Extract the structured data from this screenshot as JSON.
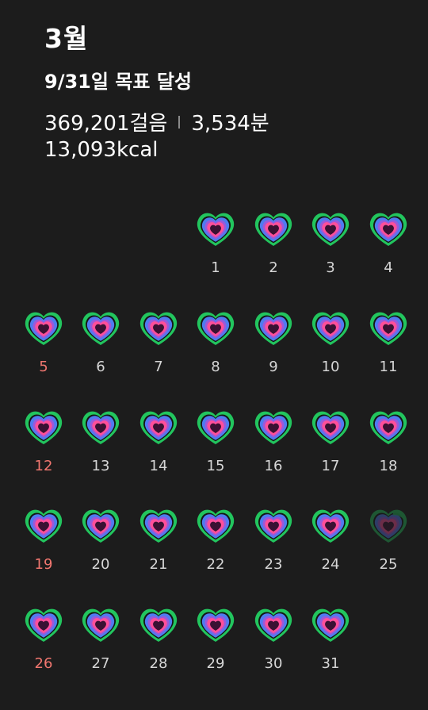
{
  "header": {
    "month": "3월",
    "goal": "9/31일 목표 달성",
    "steps": "369,201걸음",
    "minutes": "3,534분",
    "kcal": "13,093kcal"
  },
  "calendar": {
    "first_weekday_index": 3,
    "sunday_color": "#f0766f",
    "ring_colors": [
      "#22c55e",
      "#4f7bf0",
      "#9b59d9",
      "#ff4f9a",
      "#3a1133"
    ],
    "days": [
      {
        "label": "1",
        "sunday": false,
        "complete": true
      },
      {
        "label": "2",
        "sunday": false,
        "complete": true
      },
      {
        "label": "3",
        "sunday": false,
        "complete": true
      },
      {
        "label": "4",
        "sunday": false,
        "complete": true
      },
      {
        "label": "5",
        "sunday": true,
        "complete": true
      },
      {
        "label": "6",
        "sunday": false,
        "complete": true
      },
      {
        "label": "7",
        "sunday": false,
        "complete": true
      },
      {
        "label": "8",
        "sunday": false,
        "complete": true
      },
      {
        "label": "9",
        "sunday": false,
        "complete": true
      },
      {
        "label": "10",
        "sunday": false,
        "complete": true
      },
      {
        "label": "11",
        "sunday": false,
        "complete": true
      },
      {
        "label": "12",
        "sunday": true,
        "complete": true
      },
      {
        "label": "13",
        "sunday": false,
        "complete": true
      },
      {
        "label": "14",
        "sunday": false,
        "complete": true
      },
      {
        "label": "15",
        "sunday": false,
        "complete": true
      },
      {
        "label": "16",
        "sunday": false,
        "complete": true
      },
      {
        "label": "17",
        "sunday": false,
        "complete": true
      },
      {
        "label": "18",
        "sunday": false,
        "complete": true
      },
      {
        "label": "19",
        "sunday": true,
        "complete": true
      },
      {
        "label": "20",
        "sunday": false,
        "complete": true
      },
      {
        "label": "21",
        "sunday": false,
        "complete": true
      },
      {
        "label": "22",
        "sunday": false,
        "complete": true
      },
      {
        "label": "23",
        "sunday": false,
        "complete": true
      },
      {
        "label": "24",
        "sunday": false,
        "complete": true
      },
      {
        "label": "25",
        "sunday": false,
        "complete": false
      },
      {
        "label": "26",
        "sunday": true,
        "complete": true
      },
      {
        "label": "27",
        "sunday": false,
        "complete": true
      },
      {
        "label": "28",
        "sunday": false,
        "complete": true
      },
      {
        "label": "29",
        "sunday": false,
        "complete": true
      },
      {
        "label": "30",
        "sunday": false,
        "complete": true
      },
      {
        "label": "31",
        "sunday": false,
        "complete": true
      }
    ]
  }
}
